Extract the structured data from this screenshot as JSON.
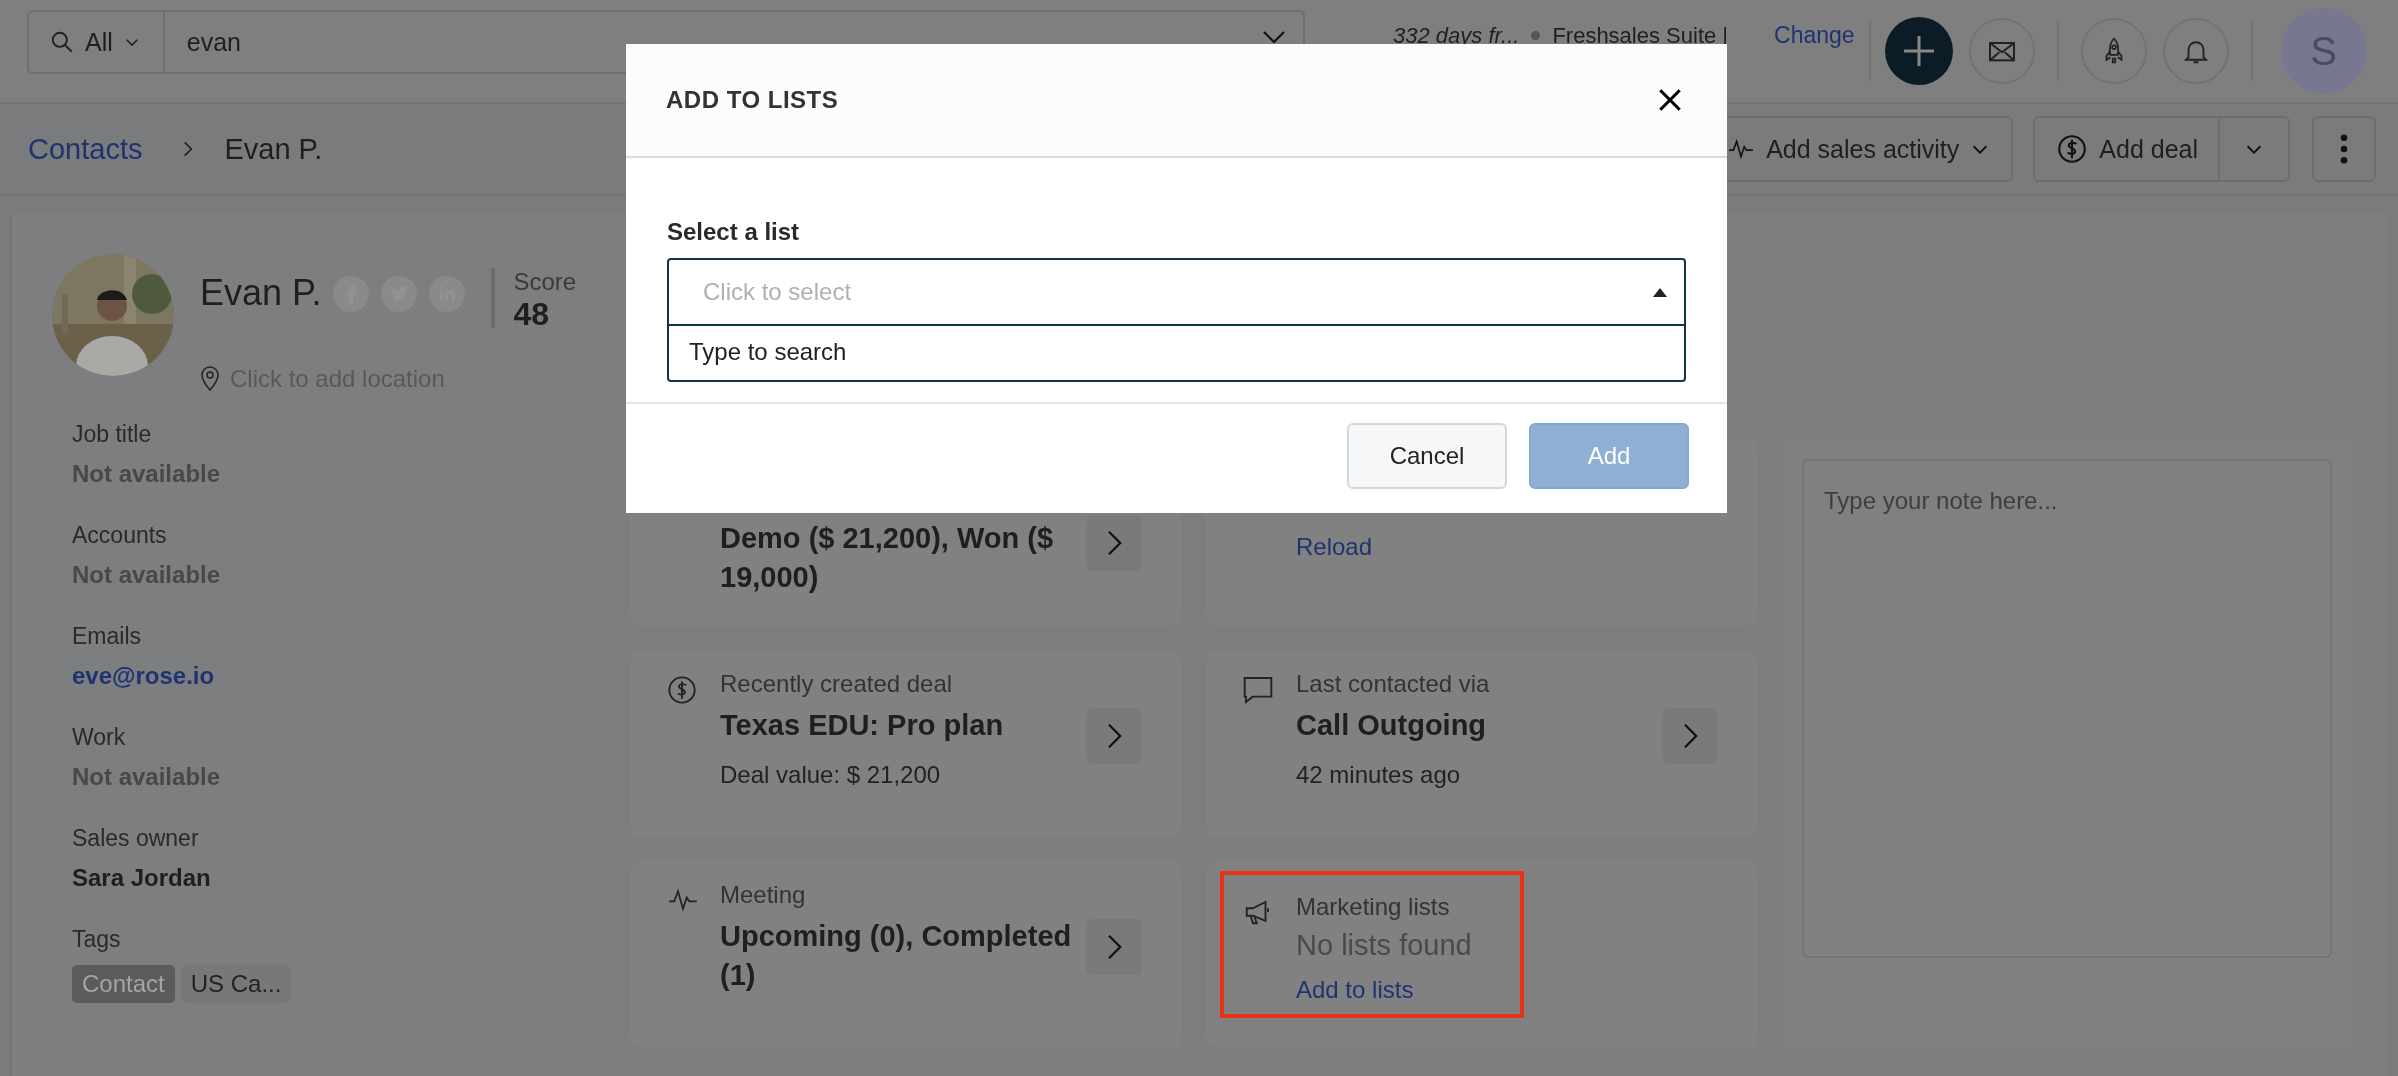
{
  "top_bar": {
    "search": {
      "scope": "All",
      "value": "evan"
    },
    "trial": "332 days fr...",
    "plan": "Freshsales Suite |",
    "change_link": "Change",
    "avatar_initial": "S"
  },
  "breadcrumb": [
    {
      "label": "Contacts",
      "kind": "link"
    },
    {
      "label": "Evan P.",
      "kind": "current"
    }
  ],
  "actions": {
    "sales_activity": "Add sales activity",
    "deal": "Add deal"
  },
  "contact": {
    "name": "Evan P.",
    "score_label": "Score",
    "score": "48",
    "location_placeholder": "Click to add location",
    "fields": [
      {
        "label": "Job title",
        "value": "Not available",
        "kind": "empty"
      },
      {
        "label": "Accounts",
        "value": "Not available",
        "kind": "empty"
      },
      {
        "label": "Emails",
        "value": "eve@rose.io",
        "kind": "link"
      },
      {
        "label": "Work",
        "value": "Not available",
        "kind": "empty"
      },
      {
        "label": "Sales owner",
        "value": "Sara Jordan",
        "kind": "text"
      }
    ],
    "tags_label": "Tags",
    "tags": [
      {
        "label": "Contact",
        "kind": "primary"
      },
      {
        "label": "US Ca...",
        "kind": "default"
      }
    ]
  },
  "highlights": [
    {
      "kind": "summary",
      "value": "Demo ($ 21,200), Won ($ 19,000)",
      "arrow": true
    },
    {
      "kind": "error",
      "link": "Reload",
      "arrow": false
    },
    {
      "kind": "deal",
      "label": "Recently created deal",
      "value": "Texas EDU: Pro plan",
      "detail": "Deal value: $ 21,200",
      "arrow": true
    },
    {
      "kind": "contacted",
      "label": "Last contacted via",
      "value": "Call Outgoing",
      "detail": "42 minutes ago",
      "arrow": true
    },
    {
      "kind": "meeting",
      "label": "Meeting",
      "value": "Upcoming (0), Completed (1)",
      "arrow": true
    },
    {
      "kind": "lists",
      "label": "Marketing lists",
      "status": "No lists found",
      "link": "Add to lists",
      "arrow": false,
      "highlighted": true
    }
  ],
  "note": {
    "placeholder": "Type your note here..."
  },
  "modal": {
    "title": "ADD TO LISTS",
    "field_label": "Select a list",
    "placeholder": "Click to select",
    "expanded": true,
    "dropdown_hint": "Type to search",
    "buttons": [
      {
        "label": "Cancel",
        "kind": "secondary",
        "disabled": false
      },
      {
        "label": "Add",
        "kind": "primary",
        "disabled": true
      }
    ]
  }
}
